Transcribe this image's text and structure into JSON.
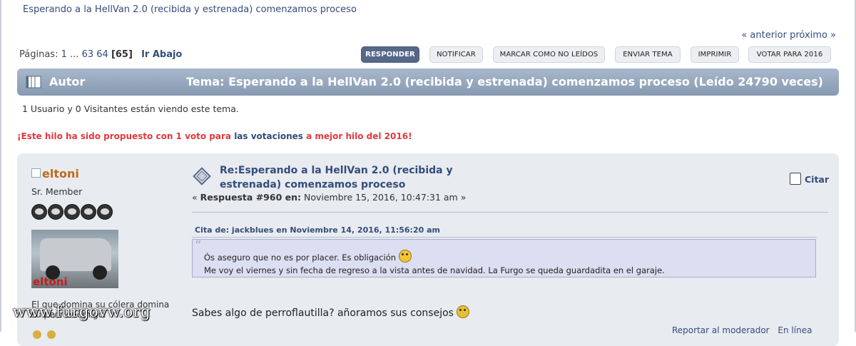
{
  "topic_link": "Esperando a la HellVan 2.0 (recibida y estrenada) comenzamos proceso",
  "nav": {
    "prev": "« anterior",
    "next": "próximo »"
  },
  "pagination": {
    "label": "Páginas:",
    "first": "1",
    "ellipsis": "...",
    "p63": "63",
    "p64": "64",
    "current": "[65]",
    "goto_bottom": "Ir Abajo"
  },
  "buttons": {
    "reply": "RESPONDER",
    "notify": "NOTIFICAR",
    "mark_unread": "MARCAR COMO NO LEÍDOS",
    "send_topic": "ENVIAR TEMA",
    "print": "IMPRIMIR",
    "vote": "VOTAR PARA 2016"
  },
  "header_bar": {
    "author": "Autor",
    "topic": "Tema: Esperando a la HellVan 2.0 (recibida y estrenada) comenzamos proceso  (Leído 24790 veces)"
  },
  "viewers": "1 Usuario y 0 Visitantes están viendo este tema.",
  "notice": {
    "part1": "¡Este hilo ha sido propuesto con 1 voto para ",
    "link": "las votaciones",
    "part2": " a mejor hilo del 2016!"
  },
  "post": {
    "author": "eltoni",
    "rank": "Sr. Member",
    "avatar_caption": "eltoni",
    "signature": "El que domina su cólera domina su peor enemigo.",
    "title": "Re:Esperando a la HellVan 2.0 (recibida y estrenada) comenzamos proceso",
    "meta_prefix": "« ",
    "meta_reply": "Respuesta #960 en:",
    "meta_date": " Noviembre 15, 2016, 10:47:31 am »",
    "cite": "Citar",
    "quote_header": "Cita de: jackblues en Noviembre 14, 2016, 11:56:20 am",
    "quote_line1": "Ós aseguro que no es por placer. Es obligación",
    "quote_line2": "Me voy el viernes y sin fecha de regreso a la vista antes de navidad. La Furgo se queda guardadita en el garaje.",
    "body": "Sabes algo de perroflautilla? añoramos sus consejos",
    "report": "Reportar al moderador",
    "online": "En línea"
  },
  "watermark": "www.furgovw.org",
  "colors": {
    "accent": "#334d7a",
    "header_bar": "#8799b1",
    "notice_red": "#e0393e",
    "username": "#c06a18"
  }
}
